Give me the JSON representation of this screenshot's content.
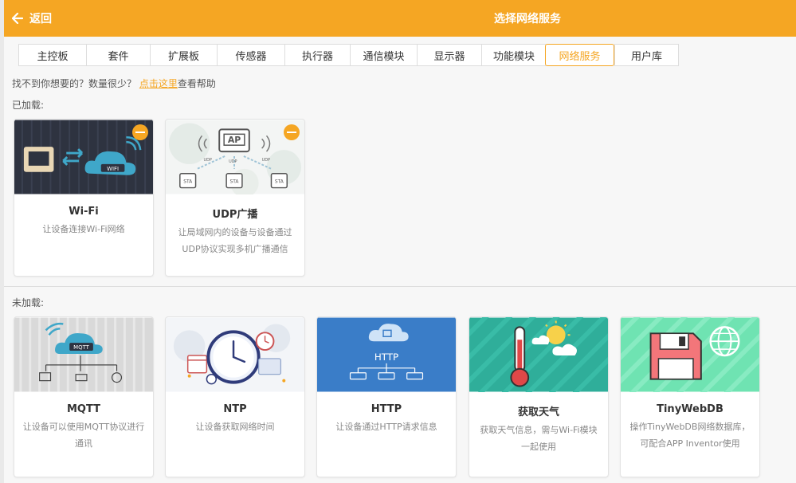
{
  "header": {
    "back_label": "返回",
    "title": "选择网络服务",
    "color": "#f5a623"
  },
  "tabs": [
    {
      "label": "主控板"
    },
    {
      "label": "套件"
    },
    {
      "label": "扩展板"
    },
    {
      "label": "传感器"
    },
    {
      "label": "执行器"
    },
    {
      "label": "通信模块"
    },
    {
      "label": "显示器"
    },
    {
      "label": "功能模块"
    },
    {
      "label": "网络服务",
      "active": true
    },
    {
      "label": "用户库"
    }
  ],
  "hint": {
    "before": "找不到你想要的？数量很少？ ",
    "link": "点击这里",
    "after": "查看帮助"
  },
  "loaded": {
    "label": "已加载:",
    "cards": [
      {
        "name": "Wi-Fi",
        "desc1": "让设备连接Wi-Fi网络",
        "desc2": "",
        "image_text": "WIFI"
      },
      {
        "name": "UDP广播",
        "desc1": "让局域网内的设备与设备通过",
        "desc2": "UDP协议实现多机广播通信",
        "image_text": "AP",
        "udp": "UDP",
        "sta": "STA"
      }
    ]
  },
  "unloaded": {
    "label": "未加载:",
    "cards": [
      {
        "name": "MQTT",
        "desc1": "让设备可以使用MQTT协议进行",
        "desc2": "通讯",
        "image_text": "MQTT"
      },
      {
        "name": "NTP",
        "desc1": "让设备获取网络时间",
        "desc2": ""
      },
      {
        "name": "HTTP",
        "desc1": "让设备通过HTTP请求信息",
        "desc2": "",
        "image_text": "HTTP"
      },
      {
        "name": "获取天气",
        "desc1": "获取天气信息，需与Wi-Fi模块",
        "desc2": "一起使用"
      },
      {
        "name": "TinyWebDB",
        "desc1": "操作TinyWebDB网络数据库，",
        "desc2": "可配合APP Inventor使用"
      }
    ]
  }
}
